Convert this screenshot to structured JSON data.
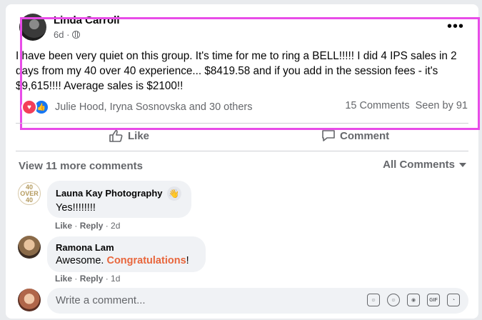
{
  "post": {
    "author": "Linda Carroll",
    "time": "6d ·",
    "text": "I have been very quiet on this group. It's time for me to ring a BELL!!!!! I did 4 IPS sales in 2 days from my 40 over 40 experience... $8419.58 and if you add in the session fees - it's $9,615!!!! Average sales is $2100!!",
    "reaction_names": "Julie Hood, Iryna Sosnovska and 30 others",
    "comments_count": "15 Comments",
    "seen_by": "Seen by 91"
  },
  "actions": {
    "like": "Like",
    "comment": "Comment"
  },
  "comments_header": {
    "view_more": "View 11 more comments",
    "sort": "All Comments"
  },
  "comments": [
    {
      "avatar_text": "40 OVER 40",
      "name": "Launa Kay Photography",
      "text": "Yes!!!!!!!!",
      "like": "Like",
      "reply": "Reply",
      "time": "2d"
    },
    {
      "name": "Ramona Lam",
      "text_before": "Awesome. ",
      "text_highlight": "Congratulations",
      "text_after": "!",
      "like": "Like",
      "reply": "Reply",
      "time": "1d"
    }
  ],
  "composer": {
    "placeholder": "Write a comment..."
  },
  "icons": [
    "more-icon",
    "globe-icon",
    "love-reaction-icon",
    "like-reaction-icon",
    "like-icon",
    "comment-icon",
    "caret-down-icon",
    "wave-icon",
    "sticker-icon",
    "emoji-icon",
    "camera-icon",
    "gif-icon",
    "avatar-sticker-icon"
  ],
  "colors": {
    "highlight_border": "#e84ce8",
    "like_blue": "#1877f2",
    "love_red": "#f33e58",
    "congrats": "#e8663c"
  }
}
